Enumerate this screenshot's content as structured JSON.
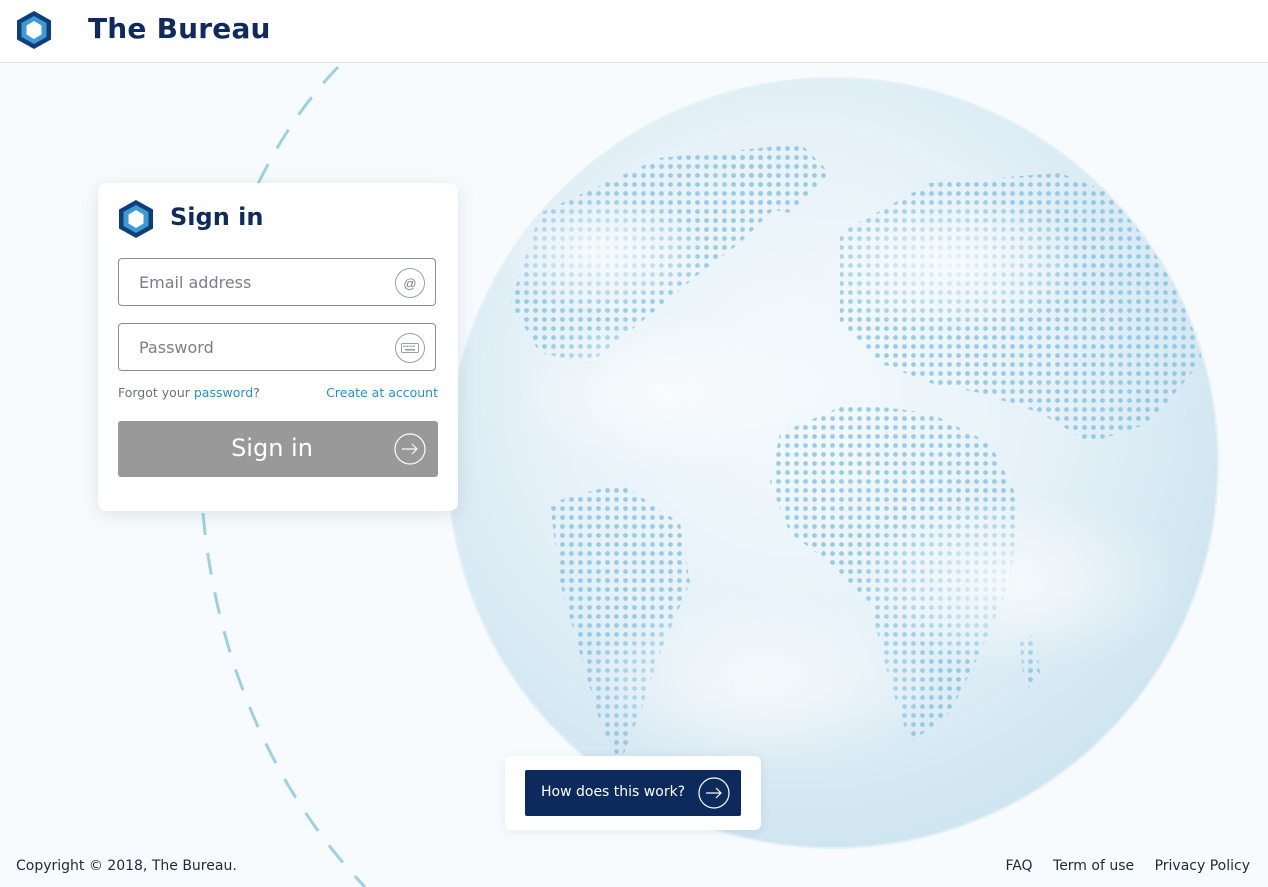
{
  "header": {
    "brand": "The Bureau"
  },
  "signin": {
    "title": "Sign in",
    "email_placeholder": "Email address",
    "email_icon": "@",
    "password_placeholder": "Password",
    "forgot_prefix": "Forgot your ",
    "forgot_link": "password",
    "forgot_suffix": "?",
    "create_link": "Create at account",
    "button_label": "Sign in"
  },
  "how": {
    "button_label": "How does this work?"
  },
  "footer": {
    "copyright": "Copyright © 2018, The Bureau.",
    "links": [
      "FAQ",
      "Term of use",
      "Privacy Policy"
    ]
  },
  "colors": {
    "brand_navy": "#0f2a5c",
    "link_blue": "#2a8fc9",
    "signin_button": "#999999",
    "how_button": "#0d2a5c"
  },
  "icons": [
    "hexagon-logo-icon",
    "at-icon",
    "keyboard-icon",
    "arrow-right-icon",
    "globe-illustration"
  ]
}
